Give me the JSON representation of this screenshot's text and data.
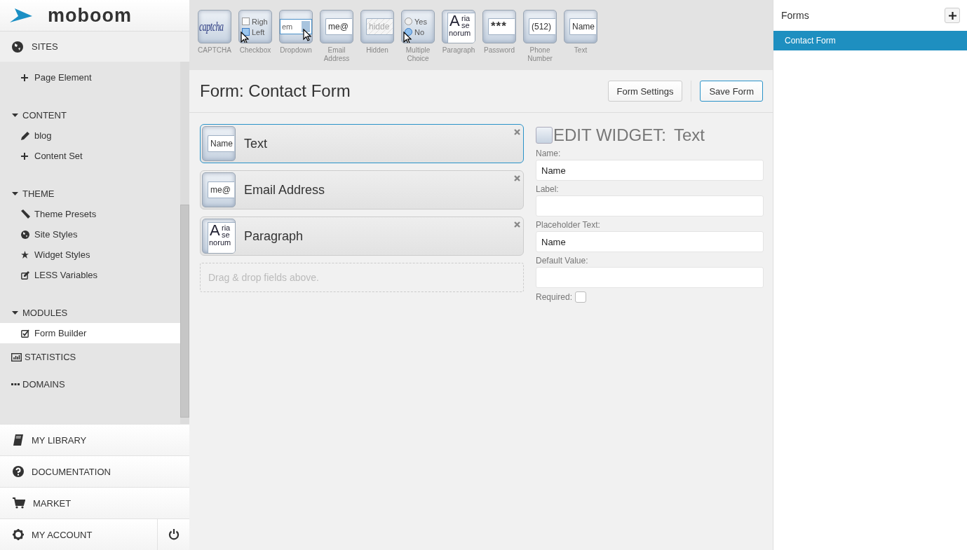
{
  "sidebar": {
    "logo": "moboom",
    "sites": {
      "label": "SITES",
      "children": [
        {
          "label": "Page Element",
          "selected": false
        }
      ]
    },
    "sections": [
      {
        "label": "CONTENT",
        "expanded": true,
        "children": [
          {
            "label": "blog",
            "selected": false
          },
          {
            "label": "Content Set",
            "selected": false
          }
        ]
      },
      {
        "label": "THEME",
        "expanded": true,
        "children": [
          {
            "label": "Theme Presets",
            "selected": false
          },
          {
            "label": "Site Styles",
            "selected": false
          },
          {
            "label": "Widget Styles",
            "selected": false
          },
          {
            "label": "LESS Variables",
            "selected": false
          }
        ]
      },
      {
        "label": "MODULES",
        "expanded": true,
        "children": [
          {
            "label": "Form Builder",
            "selected": true
          }
        ]
      }
    ],
    "top_items": [
      "STATISTICS",
      "DOMAINS"
    ],
    "bottom_menu": [
      "MY LIBRARY",
      "DOCUMENTATION",
      "MARKET",
      "MY ACCOUNT"
    ]
  },
  "toolbar": {
    "tiles": [
      {
        "label": "CAPTCHA",
        "cursor": false,
        "preview": {
          "kind": "captcha",
          "text": "captcha"
        }
      },
      {
        "label": "Checkbox",
        "cursor": true,
        "preview": {
          "kind": "checkbox",
          "options": [
            {
              "text": "Righ",
              "checked": false
            },
            {
              "text": "Left",
              "checked": true
            }
          ]
        }
      },
      {
        "label": "Dropdown",
        "cursor": true,
        "preview": {
          "kind": "dropdown",
          "text": "em"
        }
      },
      {
        "label": "Email Address",
        "cursor": false,
        "preview": {
          "kind": "input",
          "text": "me@"
        }
      },
      {
        "label": "Hidden",
        "cursor": false,
        "preview": {
          "kind": "hidden",
          "text": "hidde"
        }
      },
      {
        "label": "Multiple Choice",
        "cursor": true,
        "preview": {
          "kind": "radio",
          "options": [
            {
              "text": "Yes",
              "selected": false
            },
            {
              "text": "No",
              "selected": true
            }
          ]
        }
      },
      {
        "label": "Paragraph",
        "cursor": false,
        "preview": {
          "kind": "paragraph",
          "letter": "A",
          "lines": [
            "ria",
            "se",
            "norum"
          ]
        }
      },
      {
        "label": "Password",
        "cursor": false,
        "preview": {
          "kind": "password",
          "text": "***"
        }
      },
      {
        "label": "Phone Number",
        "cursor": false,
        "preview": {
          "kind": "input",
          "text": "(512)"
        }
      },
      {
        "label": "Text",
        "cursor": false,
        "preview": {
          "kind": "input",
          "text": "Name"
        }
      }
    ]
  },
  "form": {
    "title": "Form: Contact Form",
    "buttons": [
      {
        "label": "Form Settings",
        "kind": "default"
      },
      {
        "label": "Save Form",
        "kind": "primary"
      }
    ],
    "fields": [
      {
        "label": "Text",
        "selected": true,
        "preview": {
          "kind": "input",
          "text": "Name"
        }
      },
      {
        "label": "Email Address",
        "selected": false,
        "preview": {
          "kind": "input",
          "text": "me@"
        }
      },
      {
        "label": "Paragraph",
        "selected": false,
        "preview": {
          "kind": "paragraph",
          "letter": "A",
          "lines": [
            "ria",
            "se",
            "norum"
          ]
        }
      }
    ],
    "drop_hint": "Drag & drop fields above."
  },
  "edit_widget": {
    "heading": "EDIT WIDGET:",
    "widget": "Text",
    "fields": [
      {
        "label": "Name:",
        "value": "Name"
      },
      {
        "label": "Label:"
      },
      {
        "label": "Placeholder Text:",
        "value": "Name"
      },
      {
        "label": "Default Value:"
      }
    ],
    "required": {
      "label": "Required:",
      "checked": false
    }
  },
  "forms_panel": {
    "title": "Forms",
    "items": [
      {
        "label": "Contact Form",
        "selected": true
      }
    ]
  }
}
